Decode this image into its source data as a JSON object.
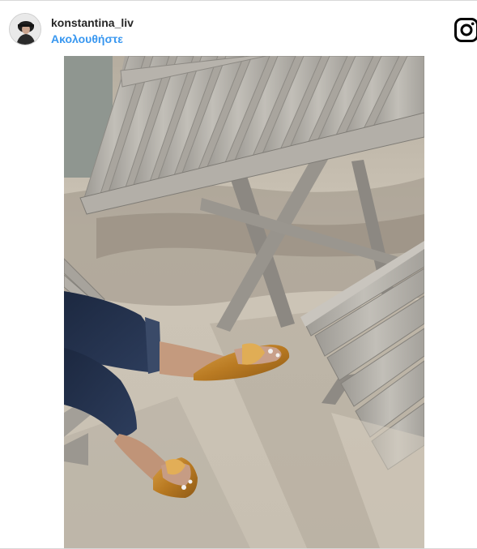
{
  "post": {
    "username": "konstantina_liv",
    "follow_label": "Ακολουθήστε"
  },
  "icons": {
    "avatar": "profile-avatar",
    "brand": "instagram-icon"
  },
  "colors": {
    "follow_link": "#3897f0",
    "username": "#262626"
  }
}
